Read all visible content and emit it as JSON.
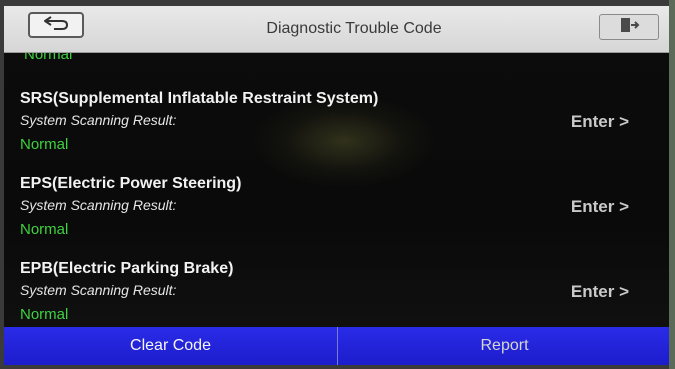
{
  "header": {
    "title": "Diagnostic Trouble Code",
    "back_icon": "return-arrow-icon",
    "exit_icon": "exit-door-icon"
  },
  "top_partial_status": "Normal",
  "systems": [
    {
      "name": "SRS(Supplemental Inflatable Restraint System)",
      "result_label": "System Scanning Result:",
      "status": "Normal",
      "enter_label": "Enter >"
    },
    {
      "name": "EPS(Electric Power Steering)",
      "result_label": "System Scanning Result:",
      "status": "Normal",
      "enter_label": "Enter >"
    },
    {
      "name": "EPB(Electric Parking Brake)",
      "result_label": "System Scanning Result:",
      "status": "Normal",
      "enter_label": "Enter >"
    }
  ],
  "footer": {
    "clear_code_label": "Clear Code",
    "report_label": "Report"
  },
  "colors": {
    "status_normal": "#3fd13f",
    "button_blue": "#2324dc",
    "titlebar_bg": "#e0e0e0"
  }
}
